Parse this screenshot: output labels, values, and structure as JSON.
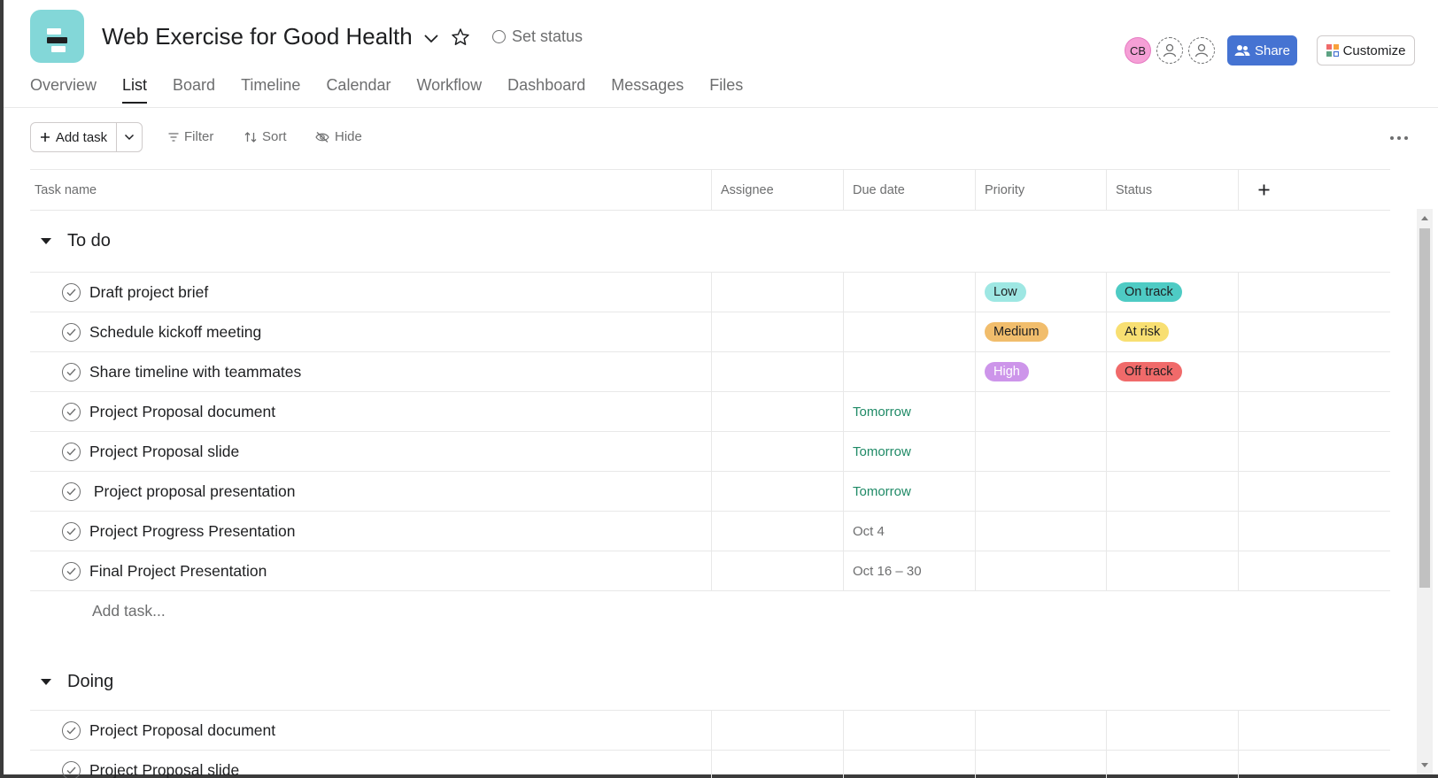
{
  "project": {
    "title": "Web Exercise for Good Health",
    "set_status_label": "Set status",
    "icon_color": "#83d7d8"
  },
  "header": {
    "avatar_initials": "CB",
    "share_label": "Share",
    "customize_label": "Customize"
  },
  "tabs": [
    {
      "label": "Overview",
      "active": false
    },
    {
      "label": "List",
      "active": true
    },
    {
      "label": "Board",
      "active": false
    },
    {
      "label": "Timeline",
      "active": false
    },
    {
      "label": "Calendar",
      "active": false
    },
    {
      "label": "Workflow",
      "active": false
    },
    {
      "label": "Dashboard",
      "active": false
    },
    {
      "label": "Messages",
      "active": false
    },
    {
      "label": "Files",
      "active": false
    }
  ],
  "toolbar": {
    "add_task_label": "Add task",
    "filter_label": "Filter",
    "sort_label": "Sort",
    "hide_label": "Hide"
  },
  "columns": {
    "task_name": "Task name",
    "assignee": "Assignee",
    "due_date": "Due date",
    "priority": "Priority",
    "status": "Status"
  },
  "sections": [
    {
      "name": "To do",
      "tasks": [
        {
          "name": "Draft project brief",
          "due": "",
          "priority": "Low",
          "status": "On track"
        },
        {
          "name": "Schedule kickoff meeting",
          "due": "",
          "priority": "Medium",
          "status": "At risk"
        },
        {
          "name": "Share timeline with teammates",
          "due": "",
          "priority": "High",
          "status": "Off track"
        },
        {
          "name": "Project Proposal document",
          "due": "Tomorrow",
          "priority": "",
          "status": ""
        },
        {
          "name": "Project Proposal slide",
          "due": "Tomorrow",
          "priority": "",
          "status": ""
        },
        {
          "name": " Project proposal presentation",
          "due": "Tomorrow",
          "priority": "",
          "status": ""
        },
        {
          "name": "Project Progress Presentation",
          "due": "Oct 4",
          "priority": "",
          "status": ""
        },
        {
          "name": "Final Project Presentation",
          "due": "Oct 16 – 30",
          "priority": "",
          "status": ""
        }
      ],
      "add_task_placeholder": "Add task..."
    },
    {
      "name": "Doing",
      "tasks": [
        {
          "name": "Project Proposal document",
          "due": "",
          "priority": "",
          "status": ""
        },
        {
          "name": "Project Proposal slide",
          "due": "",
          "priority": "",
          "status": ""
        }
      ]
    }
  ],
  "pill_colors": {
    "Low": "#9ee7e3",
    "Medium": "#f1bd6c",
    "High": "#cd95ea",
    "On track": "#4ecbc4",
    "At risk": "#f8df72",
    "Off track": "#f06a6a"
  }
}
